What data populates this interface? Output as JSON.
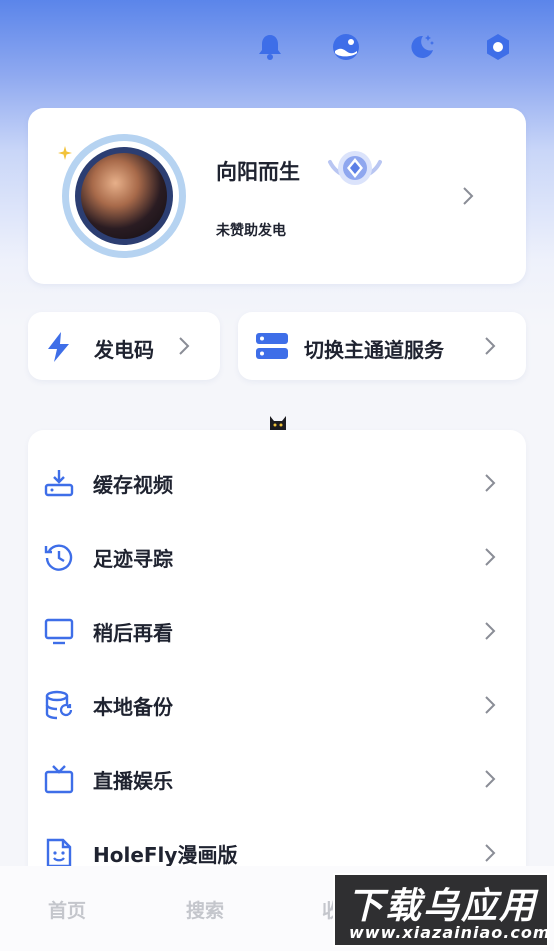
{
  "colors": {
    "accent": "#3e6ee8",
    "text": "#1f2330",
    "muted": "#c4c6cc"
  },
  "top_icons": [
    "bell-icon",
    "theme-icon",
    "night-mode-icon",
    "settings-icon"
  ],
  "profile": {
    "name": "向阳而生",
    "status": "未赞助发电",
    "badge": "medal-icon"
  },
  "quick": {
    "charge_code": "发电码",
    "switch_server": "切换主通道服务"
  },
  "menu": {
    "items": [
      {
        "label": "缓存视频",
        "icon": "download-icon"
      },
      {
        "label": "足迹寻踪",
        "icon": "history-icon"
      },
      {
        "label": "稍后再看",
        "icon": "monitor-icon"
      },
      {
        "label": "本地备份",
        "icon": "database-icon"
      },
      {
        "label": "直播娱乐",
        "icon": "tv-icon"
      },
      {
        "label": "HoleFly漫画版",
        "icon": "comic-icon"
      }
    ]
  },
  "nav": {
    "home": "首页",
    "search": "搜索",
    "partial": "收"
  },
  "watermark": {
    "title": "下载乌应用",
    "url": "www.xiazainiao.com"
  }
}
